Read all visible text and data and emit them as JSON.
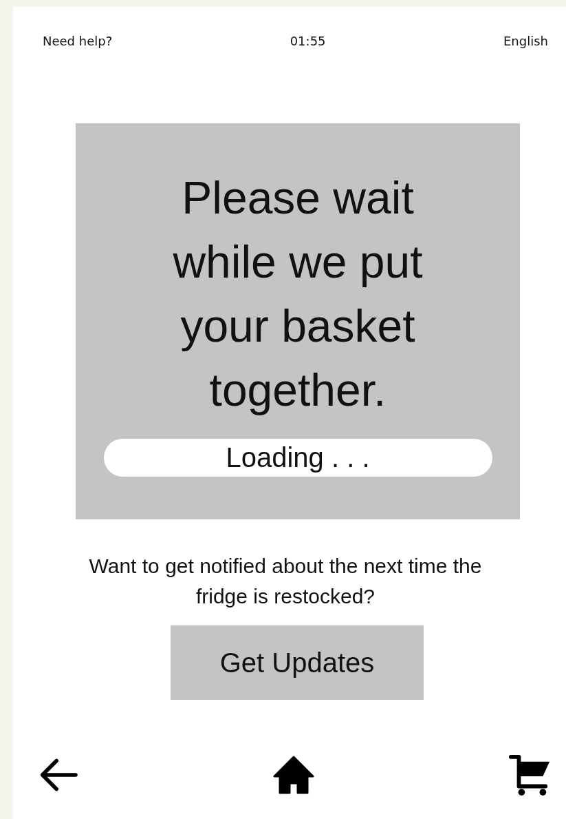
{
  "header": {
    "help_link": "Need help?",
    "timer": "01:55",
    "language": "English"
  },
  "status_panel": {
    "message": "Please wait while we put your basket together.",
    "loading": "Loading . . ."
  },
  "notify": {
    "question": "Want to get notified about the next time the fridge is restocked?",
    "button": "Get Updates"
  },
  "nav": [
    {
      "kind": "back"
    },
    {
      "kind": "home"
    },
    {
      "kind": "cart"
    }
  ]
}
